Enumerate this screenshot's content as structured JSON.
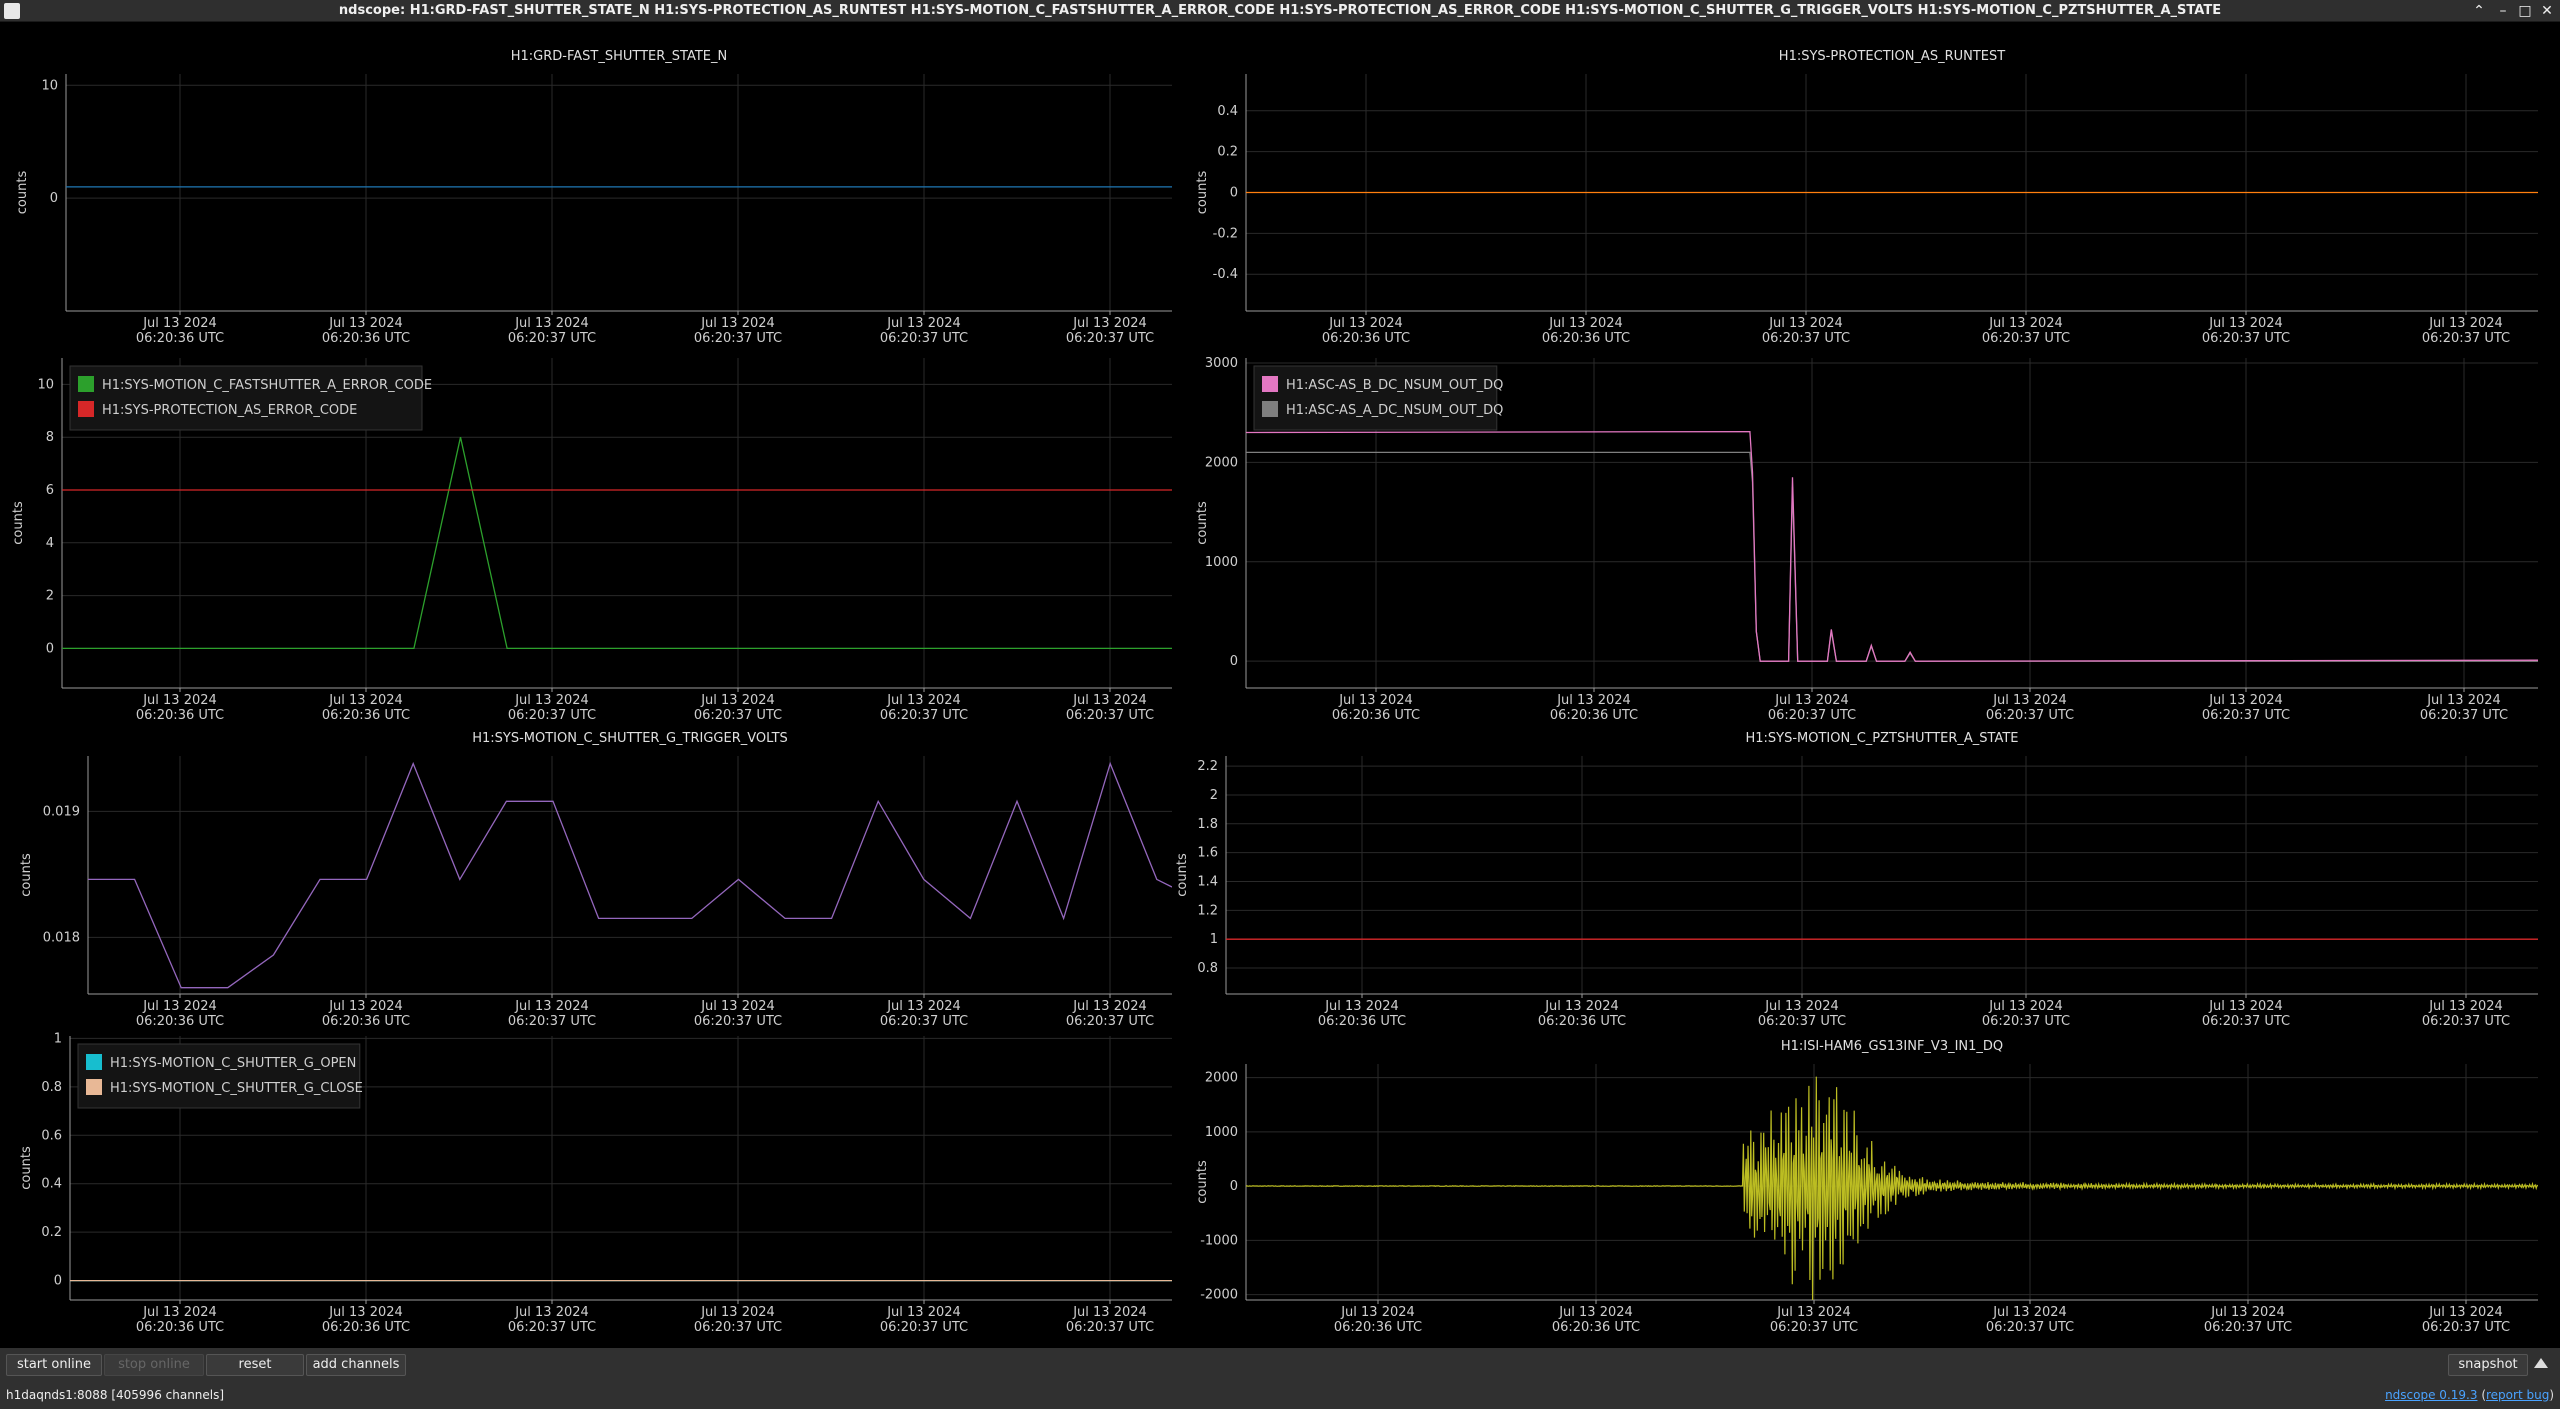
{
  "window": {
    "title": "ndscope: H1:GRD-FAST_SHUTTER_STATE_N H1:SYS-PROTECTION_AS_RUNTEST H1:SYS-MOTION_C_FASTSHUTTER_A_ERROR_CODE H1:SYS-PROTECTION_AS_ERROR_CODE H1:SYS-MOTION_C_SHUTTER_G_TRIGGER_VOLTS H1:SYS-MOTION_C_PZTSHUTTER_A_STATE",
    "controls": [
      "⌃",
      "–",
      "□",
      "✕"
    ]
  },
  "x_tick": {
    "line1": "Jul 13 2024",
    "line2_a": "06:20:36 UTC",
    "line2_b": "06:20:37 UTC"
  },
  "ylabel": "counts",
  "colors": {
    "blue": "#1f77b4",
    "orange": "#ff7f0e",
    "green": "#2ca02c",
    "red": "#d62728",
    "pink": "#e377c2",
    "gray": "#7f7f7f",
    "purple": "#9467bd",
    "cyan": "#17becf",
    "tan": "#e8b896",
    "olive": "#bcbd22"
  },
  "chart_data": [
    {
      "id": "p1",
      "type": "line",
      "title": "H1:GRD-FAST_SHUTTER_STATE_N",
      "ylabel": "counts",
      "yticks": [
        10,
        0
      ],
      "ylim": [
        -10,
        11
      ],
      "xlim": [
        0,
        1
      ],
      "series": [
        {
          "color": "blue",
          "points": [
            [
              0,
              1
            ],
            [
              1,
              1
            ]
          ]
        }
      ]
    },
    {
      "id": "p2",
      "type": "line",
      "title": "H1:SYS-PROTECTION_AS_RUNTEST",
      "ylabel": "counts",
      "yticks": [
        0.4,
        0.2,
        0,
        -0.2,
        -0.4
      ],
      "ylim": [
        -0.58,
        0.58
      ],
      "xlim": [
        0,
        1
      ],
      "series": [
        {
          "color": "orange",
          "points": [
            [
              0,
              0
            ],
            [
              1,
              0
            ]
          ]
        }
      ]
    },
    {
      "id": "p3",
      "type": "line",
      "title": "",
      "ylabel": "counts",
      "yticks": [
        10,
        8,
        6,
        4,
        2,
        0
      ],
      "ylim": [
        -1.5,
        11
      ],
      "xlim": [
        0,
        1
      ],
      "legend": [
        {
          "name": "H1:SYS-MOTION_C_FASTSHUTTER_A_ERROR_CODE",
          "color": "green"
        },
        {
          "name": "H1:SYS-PROTECTION_AS_ERROR_CODE",
          "color": "red"
        }
      ],
      "series": [
        {
          "color": "green",
          "points": [
            [
              0,
              0
            ],
            [
              0.317,
              0
            ],
            [
              0.359,
              8
            ],
            [
              0.401,
              0
            ],
            [
              1,
              0
            ]
          ]
        },
        {
          "color": "red",
          "points": [
            [
              0,
              6
            ],
            [
              1,
              6
            ]
          ]
        }
      ]
    },
    {
      "id": "p4",
      "type": "line",
      "title": "",
      "ylabel": "counts",
      "yticks": [
        3000,
        2000,
        1000,
        0
      ],
      "ylim": [
        -270,
        3050
      ],
      "xlim": [
        0,
        1
      ],
      "legend": [
        {
          "name": "H1:ASC-AS_B_DC_NSUM_OUT_DQ",
          "color": "pink"
        },
        {
          "name": "H1:ASC-AS_A_DC_NSUM_OUT_DQ",
          "color": "gray"
        }
      ],
      "series": [
        {
          "color": "gray",
          "points": [
            [
              0,
              2100
            ],
            [
              0.39,
              2100
            ],
            [
              0.392,
              1800
            ],
            [
              0.395,
              300
            ],
            [
              0.398,
              0
            ],
            [
              0.42,
              0
            ],
            [
              0.423,
              1750
            ],
            [
              0.427,
              0
            ],
            [
              0.45,
              0
            ],
            [
              0.453,
              300
            ],
            [
              0.457,
              0
            ],
            [
              0.48,
              0
            ],
            [
              0.484,
              150
            ],
            [
              0.488,
              0
            ],
            [
              0.51,
              0
            ],
            [
              0.514,
              80
            ],
            [
              0.518,
              0
            ],
            [
              1,
              0
            ]
          ]
        },
        {
          "color": "pink",
          "points": [
            [
              0,
              2300
            ],
            [
              0.39,
              2310
            ],
            [
              0.392,
              1900
            ],
            [
              0.395,
              300
            ],
            [
              0.398,
              0
            ],
            [
              0.42,
              0
            ],
            [
              0.423,
              1850
            ],
            [
              0.427,
              0
            ],
            [
              0.45,
              0
            ],
            [
              0.453,
              320
            ],
            [
              0.457,
              0
            ],
            [
              0.48,
              0
            ],
            [
              0.484,
              160
            ],
            [
              0.488,
              0
            ],
            [
              0.51,
              0
            ],
            [
              0.514,
              90
            ],
            [
              0.518,
              0
            ],
            [
              1,
              10
            ]
          ]
        }
      ]
    },
    {
      "id": "p5",
      "type": "line",
      "title": "H1:SYS-MOTION_C_SHUTTER_G_TRIGGER_VOLTS",
      "ylabel": "counts",
      "yticks": [
        0.019,
        0.018
      ],
      "ylim": [
        0.01755,
        0.01944
      ],
      "xlim": [
        0,
        1
      ],
      "series": [
        {
          "color": "purple",
          "points": [
            [
              0,
              0.01846
            ],
            [
              0.043,
              0.01846
            ],
            [
              0.086,
              0.0176
            ],
            [
              0.129,
              0.0176
            ],
            [
              0.171,
              0.01786
            ],
            [
              0.214,
              0.01846
            ],
            [
              0.257,
              0.01846
            ],
            [
              0.3,
              0.01938
            ],
            [
              0.343,
              0.01846
            ],
            [
              0.386,
              0.01908
            ],
            [
              0.429,
              0.01908
            ],
            [
              0.471,
              0.01815
            ],
            [
              0.514,
              0.01815
            ],
            [
              0.557,
              0.01815
            ],
            [
              0.6,
              0.01846
            ],
            [
              0.643,
              0.01815
            ],
            [
              0.686,
              0.01815
            ],
            [
              0.729,
              0.01908
            ],
            [
              0.771,
              0.01846
            ],
            [
              0.814,
              0.01815
            ],
            [
              0.857,
              0.01908
            ],
            [
              0.9,
              0.01815
            ],
            [
              0.943,
              0.01938
            ],
            [
              0.986,
              0.01846
            ],
            [
              1,
              0.0184
            ]
          ]
        }
      ]
    },
    {
      "id": "p6",
      "type": "line",
      "title": "H1:SYS-MOTION_C_PZTSHUTTER_A_STATE",
      "ylabel": "counts",
      "yticks": [
        2.2,
        2,
        1.8,
        1.6,
        1.4,
        1.2,
        1,
        0.8
      ],
      "ylim": [
        0.62,
        2.27
      ],
      "xlim": [
        0,
        1
      ],
      "series": [
        {
          "color": "red",
          "points": [
            [
              0,
              1
            ],
            [
              1,
              1
            ]
          ]
        }
      ]
    },
    {
      "id": "p7",
      "type": "line",
      "title": "",
      "ylabel": "counts",
      "yticks": [
        1,
        0.8,
        0.6,
        0.4,
        0.2,
        0
      ],
      "ylim": [
        -0.08,
        1.01
      ],
      "xlim": [
        0,
        1
      ],
      "legend": [
        {
          "name": "H1:SYS-MOTION_C_SHUTTER_G_OPEN",
          "color": "cyan"
        },
        {
          "name": "H1:SYS-MOTION_C_SHUTTER_G_CLOSE",
          "color": "tan"
        }
      ],
      "series": [
        {
          "color": "cyan",
          "points": [
            [
              0,
              0
            ],
            [
              1,
              0
            ]
          ]
        },
        {
          "color": "tan",
          "points": [
            [
              0,
              0
            ],
            [
              1,
              0
            ]
          ]
        }
      ]
    },
    {
      "id": "p8",
      "type": "line",
      "title": "H1:ISI-HAM6_GS13INF_V3_IN1_DQ",
      "ylabel": "counts",
      "yticks": [
        2000,
        1000,
        0,
        -1000,
        -2000
      ],
      "ylim": [
        -2100,
        2250
      ],
      "xlim": [
        0,
        1
      ],
      "series": [
        {
          "color": "olive",
          "noise": {
            "flat_end": 0.385,
            "peak_amp": 1900,
            "peak_at": 0.44,
            "tail": 40
          }
        }
      ]
    }
  ],
  "toolbar": {
    "start_online": "start online",
    "stop_online": "stop online",
    "reset": "reset",
    "add_channels": "add channels",
    "snapshot": "snapshot"
  },
  "status": {
    "server": "h1daqnds1:8088  [405996 channels]",
    "version": "ndscope 0.19.3",
    "report_open": "(",
    "report_bug": "report bug",
    "report_close": ")"
  }
}
